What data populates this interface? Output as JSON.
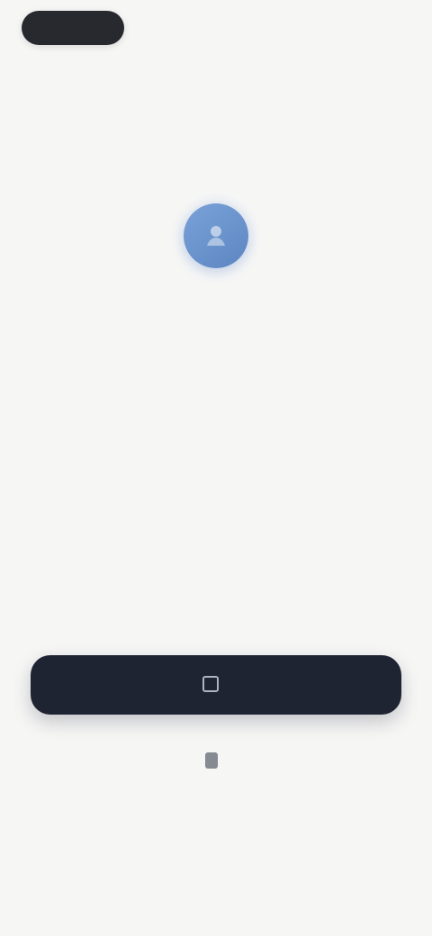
{
  "status_bar": {
    "left_pill": "",
    "right_status": ""
  },
  "hero": {
    "icon": "user-icon",
    "headline": "",
    "subtext": ""
  },
  "actions": {
    "primary_label": "",
    "secondary_label": ""
  },
  "footer": {
    "title": "",
    "text": ""
  },
  "colors": {
    "background": "#f6f6f5",
    "primary_button": "#1f2433",
    "accent_icon": "#6f96d0"
  }
}
